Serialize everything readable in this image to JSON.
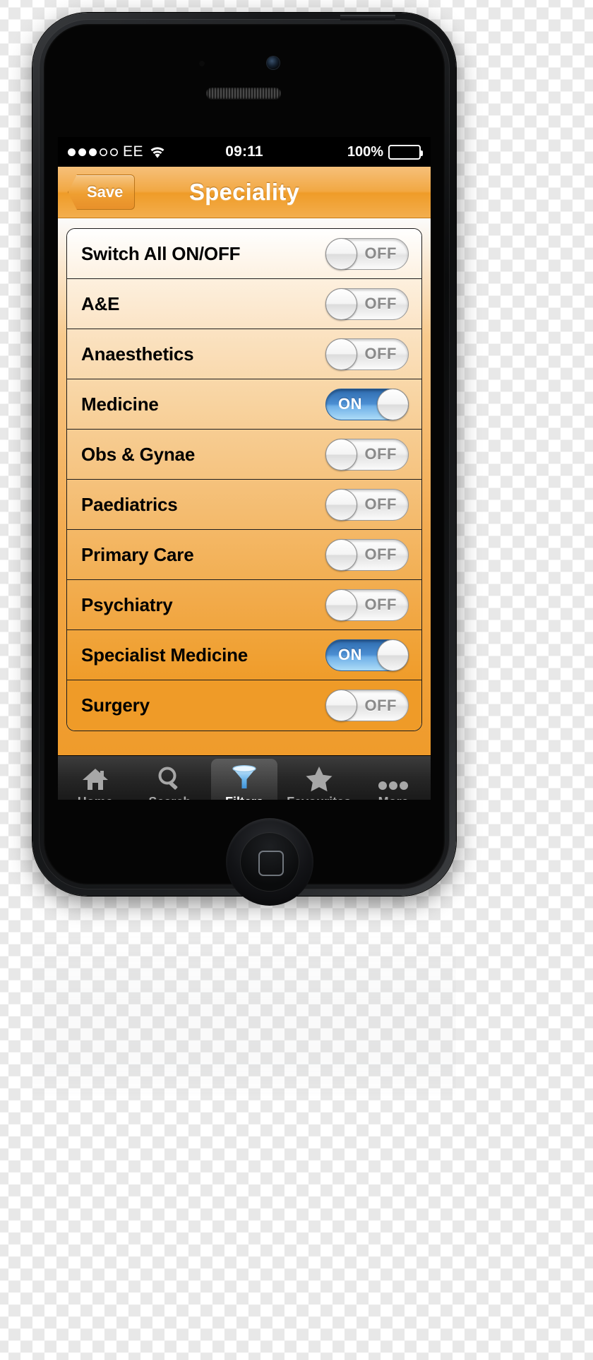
{
  "status_bar": {
    "signal_dots_filled": 3,
    "signal_dots_total": 5,
    "carrier": "EE",
    "wifi_icon": "wifi-icon",
    "time": "09:11",
    "battery_percent": "100%",
    "battery_level": 100
  },
  "nav_bar": {
    "back_label": "Save",
    "title": "Speciality"
  },
  "list": {
    "rows": [
      {
        "label": "Switch All ON/OFF",
        "state": "OFF"
      },
      {
        "label": "A&E",
        "state": "OFF"
      },
      {
        "label": "Anaesthetics",
        "state": "OFF"
      },
      {
        "label": "Medicine",
        "state": "ON"
      },
      {
        "label": "Obs & Gynae",
        "state": "OFF"
      },
      {
        "label": "Paediatrics",
        "state": "OFF"
      },
      {
        "label": "Primary Care",
        "state": "OFF"
      },
      {
        "label": "Psychiatry",
        "state": "OFF"
      },
      {
        "label": "Specialist Medicine",
        "state": "ON"
      },
      {
        "label": "Surgery",
        "state": "OFF"
      }
    ]
  },
  "tab_bar": {
    "items": [
      {
        "label": "Home",
        "icon": "home-icon",
        "active": false
      },
      {
        "label": "Search",
        "icon": "search-icon",
        "active": false
      },
      {
        "label": "Filters",
        "icon": "funnel-icon",
        "active": true
      },
      {
        "label": "Favourites",
        "icon": "star-icon",
        "active": false
      },
      {
        "label": "More",
        "icon": "ellipsis-icon",
        "active": false
      }
    ]
  },
  "colors": {
    "accent_orange": "#ef9c28",
    "toggle_on_blue": "#4b8ed2",
    "nav_text": "#ffffff",
    "tab_active": "#ffffff",
    "tab_inactive": "#a7a7a7"
  }
}
